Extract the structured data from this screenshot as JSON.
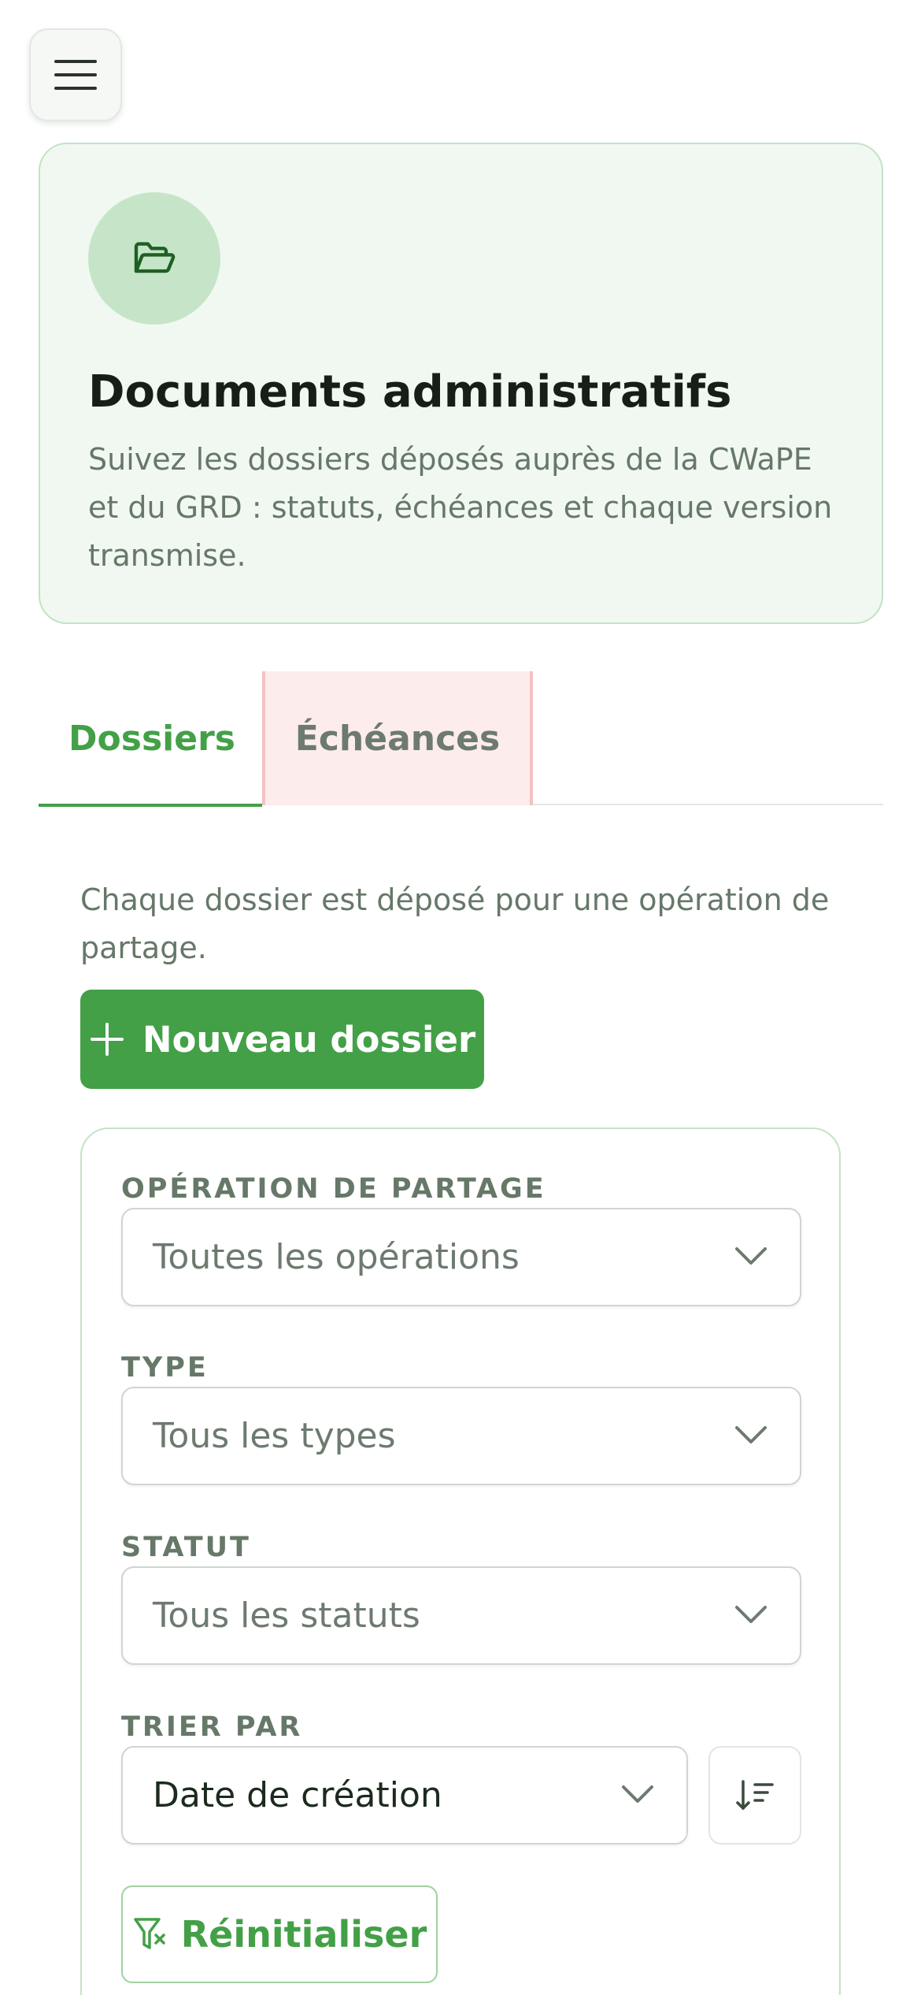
{
  "header": {
    "menu_icon": "hamburger-menu-icon"
  },
  "hero": {
    "icon": "folder-open-icon",
    "title": "Documents administratifs",
    "description": "Suivez les dossiers déposés auprès de la CWaPE et du GRD : statuts, échéances et chaque version transmise."
  },
  "tabs": [
    {
      "label": "Dossiers",
      "active": true
    },
    {
      "label": "Échéances",
      "active": false
    }
  ],
  "intro": "Chaque dossier est déposé pour une opération de partage.",
  "new_button": {
    "icon": "plus-icon",
    "label": "Nouveau dossier"
  },
  "filters": {
    "operation": {
      "label": "OPÉRATION DE PARTAGE",
      "value": "Toutes les opérations"
    },
    "type": {
      "label": "TYPE",
      "value": "Tous les types"
    },
    "status": {
      "label": "STATUT",
      "value": "Tous les statuts"
    },
    "sort": {
      "label": "TRIER PAR",
      "value": "Date de création",
      "direction_icon": "sort-descending-icon"
    },
    "reset": {
      "icon": "filter-reset-icon",
      "label": "Réinitialiser"
    }
  },
  "colors": {
    "accent": "#43a047",
    "hero_background": "#f1f8f1",
    "hero_border": "#c4e3c6",
    "tab_highlight": "#fdecec"
  }
}
